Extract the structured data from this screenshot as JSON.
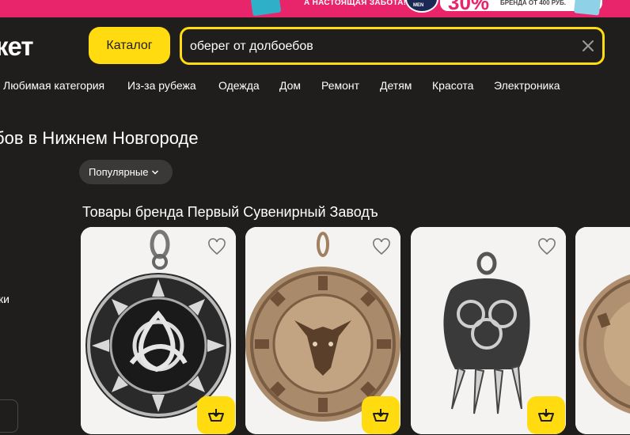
{
  "promo": {
    "slogan": "А НАСТОЯЩАЯ ЗАБОТА!",
    "badge_text": "MEN",
    "discount": "30%",
    "discount_note": "БРЕНДА ОТ 400 РУБ."
  },
  "header": {
    "logo": "кет",
    "catalog_label": "Каталог",
    "search_value": "оберег от долбоебов"
  },
  "nav": {
    "items": [
      "Любимая категория",
      "Из-за рубежа",
      "Одежда",
      "Дом",
      "Ремонт",
      "Детям",
      "Красота",
      "Электроника"
    ]
  },
  "page": {
    "title": "бов в Нижнем Новгороде",
    "sort_label": "Популярные",
    "sidebar_fragment": "ки",
    "section_title": "Товары бренда Первый Сувенирный Заводъ"
  },
  "products": [
    {
      "image": "triquetra-sun-pendant",
      "favorite": false
    },
    {
      "image": "boar-kolovrat-medallion",
      "favorite": false
    },
    {
      "image": "bear-paw-pendant",
      "favorite": false
    },
    {
      "image": "kolovrat-medallion-partial",
      "favorite": false
    }
  ],
  "colors": {
    "background": "#1f1e1d",
    "accent": "#ffdb0f",
    "promo": "#e8256a"
  }
}
